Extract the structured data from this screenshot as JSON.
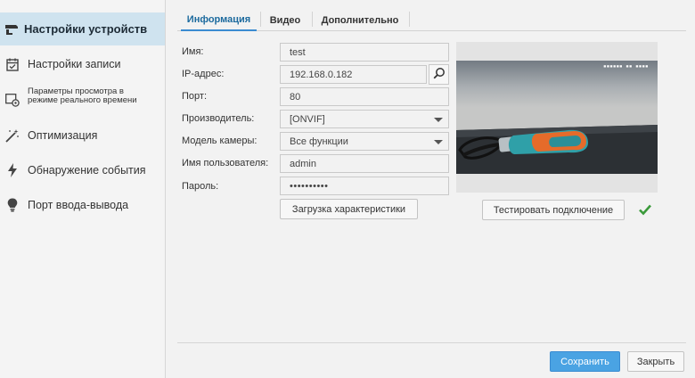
{
  "sidebar": {
    "items": [
      {
        "label": "Настройки устройств",
        "icon": "camera-icon",
        "active": true
      },
      {
        "label": "Настройки записи",
        "icon": "calendar-icon"
      },
      {
        "label": "Параметры просмотра в режиме реального времени",
        "icon": "live-view-icon"
      },
      {
        "label": "Оптимизация",
        "icon": "magic-wand-icon"
      },
      {
        "label": "Обнаружение события",
        "icon": "lightning-icon"
      },
      {
        "label": "Порт ввода-вывода",
        "icon": "lightbulb-icon"
      }
    ]
  },
  "tabs": [
    {
      "label": "Информация",
      "active": true
    },
    {
      "label": "Видео"
    },
    {
      "label": "Дополнительно"
    }
  ],
  "form": {
    "name_label": "Имя:",
    "name_value": "test",
    "ip_label": "IP-адрес:",
    "ip_value": "192.168.0.182",
    "port_label": "Порт:",
    "port_value": "80",
    "vendor_label": "Производитель:",
    "vendor_value": "[ONVIF]",
    "model_label": "Модель камеры:",
    "model_value": "Все функции",
    "user_label": "Имя пользователя:",
    "user_value": "admin",
    "password_label": "Пароль:",
    "password_value": "••••••••••",
    "load_caps_button": "Загрузка характеристики"
  },
  "preview": {
    "test_connection_button": "Тестировать подключение",
    "status_icon": "checkmark-icon",
    "status_color": "#3a9a3a"
  },
  "footer": {
    "save_button": "Сохранить",
    "close_button": "Закрыть"
  },
  "colors": {
    "accent": "#3a8bd1",
    "sidebar_active": "#cfe3ef",
    "primary_button": "#4aa3e3"
  }
}
